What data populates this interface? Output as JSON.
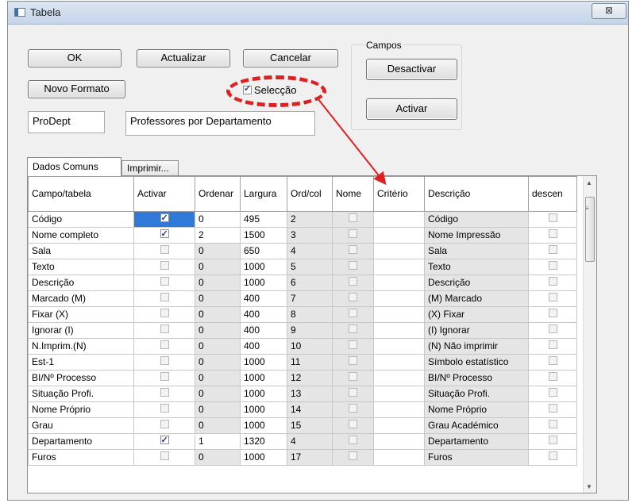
{
  "window": {
    "title": "Tabela",
    "close_glyph": "⊠"
  },
  "buttons": {
    "ok": "OK",
    "update": "Actualizar",
    "cancel": "Cancelar",
    "new_format": "Novo Formato"
  },
  "selection": {
    "label": "Selecção",
    "checked": true
  },
  "fields": {
    "code": "ProDept",
    "description": "Professores por Departamento"
  },
  "fields_group": {
    "label": "Campos",
    "deactivate": "Desactivar",
    "activate": "Activar"
  },
  "tabs": [
    "Dados Comuns",
    "Imprimir..."
  ],
  "grid": {
    "columns": [
      "Campo/tabela",
      "Activar",
      "Ordenar",
      "Largura",
      "Ord/col",
      "Nome",
      "Critério",
      "Descrição",
      "descen"
    ],
    "rows": [
      {
        "campo": "Código",
        "activar": true,
        "ordenar": "0",
        "largura": "495",
        "ordcol": "2",
        "descricao": "Código"
      },
      {
        "campo": "Nome completo",
        "activar": true,
        "ordenar": "2",
        "largura": "1500",
        "ordcol": "3",
        "descricao": "Nome Impressão"
      },
      {
        "campo": "Sala",
        "activar": false,
        "ordenar": "0",
        "largura": "650",
        "ordcol": "4",
        "descricao": "Sala"
      },
      {
        "campo": "Texto",
        "activar": false,
        "ordenar": "0",
        "largura": "1000",
        "ordcol": "5",
        "descricao": "Texto"
      },
      {
        "campo": "Descrição",
        "activar": false,
        "ordenar": "0",
        "largura": "1000",
        "ordcol": "6",
        "descricao": "Descrição"
      },
      {
        "campo": "Marcado (M)",
        "activar": false,
        "ordenar": "0",
        "largura": "400",
        "ordcol": "7",
        "descricao": "(M) Marcado"
      },
      {
        "campo": "Fixar (X)",
        "activar": false,
        "ordenar": "0",
        "largura": "400",
        "ordcol": "8",
        "descricao": "(X) Fixar"
      },
      {
        "campo": "Ignorar (I)",
        "activar": false,
        "ordenar": "0",
        "largura": "400",
        "ordcol": "9",
        "descricao": "(I) Ignorar"
      },
      {
        "campo": "N.Imprim.(N)",
        "activar": false,
        "ordenar": "0",
        "largura": "400",
        "ordcol": "10",
        "descricao": "(N) Não imprimir"
      },
      {
        "campo": "Est-1",
        "activar": false,
        "ordenar": "0",
        "largura": "1000",
        "ordcol": "11",
        "descricao": "Símbolo estatístico"
      },
      {
        "campo": "BI/Nº Processo",
        "activar": false,
        "ordenar": "0",
        "largura": "1000",
        "ordcol": "12",
        "descricao": "BI/Nº Processo"
      },
      {
        "campo": "Situação Profi.",
        "activar": false,
        "ordenar": "0",
        "largura": "1000",
        "ordcol": "13",
        "descricao": "Situação Profi."
      },
      {
        "campo": "Nome Próprio",
        "activar": false,
        "ordenar": "0",
        "largura": "1000",
        "ordcol": "14",
        "descricao": "Nome Próprio"
      },
      {
        "campo": "Grau",
        "activar": false,
        "ordenar": "0",
        "largura": "1000",
        "ordcol": "15",
        "descricao": "Grau Académico"
      },
      {
        "campo": "Departamento",
        "activar": true,
        "ordenar": "1",
        "largura": "1320",
        "ordcol": "4",
        "descricao": "Departamento"
      },
      {
        "campo": "Furos",
        "activar": false,
        "ordenar": "0",
        "largura": "1000",
        "ordcol": "17",
        "descricao": "Furos"
      }
    ]
  },
  "colors": {
    "annotation": "#e02020",
    "selected_cell": "#2f79d9"
  }
}
